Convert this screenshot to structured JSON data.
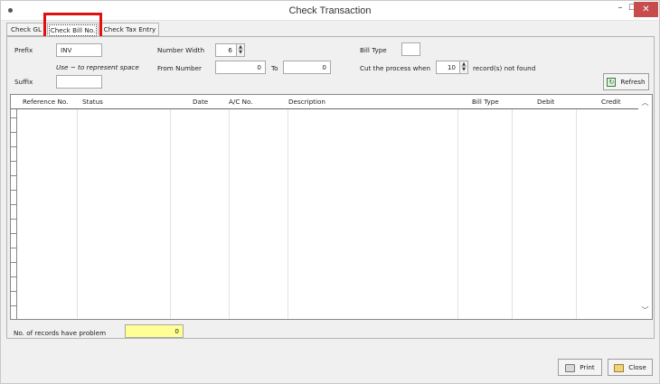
{
  "window": {
    "title": "Check Transaction",
    "minimize": "–",
    "maximize": "☐",
    "close": "✕"
  },
  "tabs": [
    {
      "label": "Check GL"
    },
    {
      "label": "Check Bill No."
    },
    {
      "label": "Check Tax Entry"
    }
  ],
  "form": {
    "prefix_label": "Prefix",
    "prefix_value": "INV",
    "hint": "Use ~ to represent space",
    "suffix_label": "Suffix",
    "suffix_value": "",
    "number_width_label": "Number Width",
    "number_width_value": "6",
    "from_number_label": "From Number",
    "from_number_value": "0",
    "to_label": "To",
    "to_value": "0",
    "bill_type_label": "Bill Type",
    "bill_type_value": "",
    "cut_label": "Cut the process when",
    "cut_value": "10",
    "cut_suffix": "record(s) not found",
    "refresh_label": "Refresh"
  },
  "grid": {
    "columns": [
      "Reference No.",
      "Status",
      "Date",
      "A/C No.",
      "Description",
      "Bill Type",
      "Debit",
      "Credit"
    ],
    "rows": []
  },
  "footer": {
    "problem_label": "No. of records have problem",
    "problem_count": "0",
    "print_label": "Print",
    "close_label": "Close"
  },
  "icons": {
    "app": "app-icon",
    "refresh": "refresh-icon",
    "print": "printer-icon",
    "close": "folder-close-icon"
  },
  "colors": {
    "highlight": "#e01010",
    "close_button": "#c74d4d",
    "problem_field": "#ffff96"
  }
}
